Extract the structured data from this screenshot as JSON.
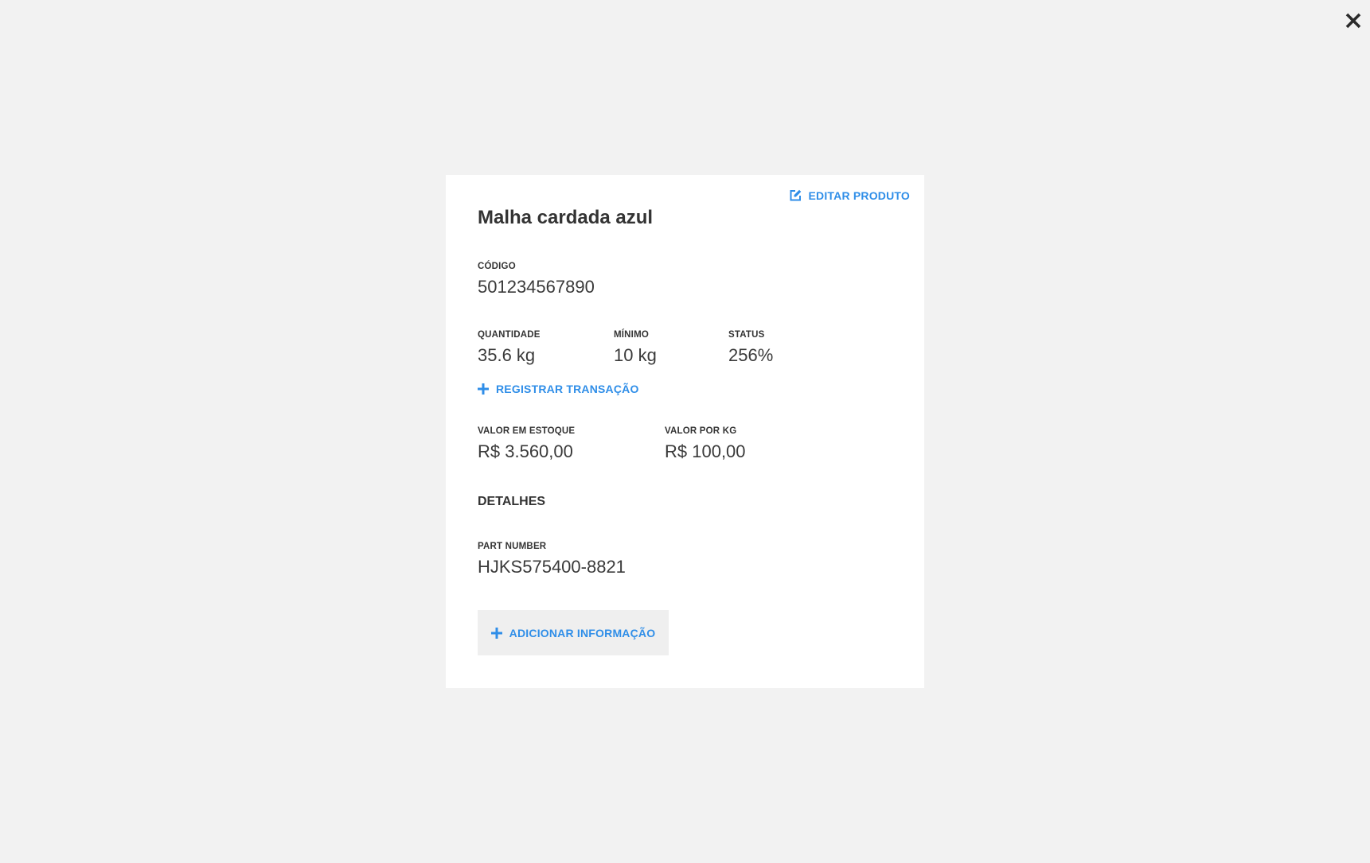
{
  "icons": {
    "close": "close-icon",
    "edit": "edit-icon",
    "plus": "plus-icon"
  },
  "colors": {
    "accent": "#2f8ee8",
    "background": "#f2f2f2",
    "card": "#ffffff",
    "button_bg": "#efefef",
    "text": "#333333"
  },
  "product": {
    "title": "Malha cardada azul",
    "edit_label": "EDITAR PRODUTO"
  },
  "fields": {
    "codigo": {
      "label": "CÓDIGO",
      "value": "501234567890"
    },
    "quantidade": {
      "label": "QUANTIDADE",
      "value": "35.6 kg"
    },
    "minimo": {
      "label": "MÍNIMO",
      "value": "10 kg"
    },
    "status": {
      "label": "STATUS",
      "value": "256%"
    },
    "valor_estoque": {
      "label": "VALOR EM ESTOQUE",
      "value": "R$ 3.560,00"
    },
    "valor_kg": {
      "label": "VALOR POR KG",
      "value": "R$ 100,00"
    }
  },
  "actions": {
    "register_transaction": "REGISTRAR TRANSAÇÃO",
    "add_info": "ADICIONAR INFORMAÇÃO"
  },
  "details": {
    "heading": "DETALHES",
    "items": [
      {
        "label": "PART NUMBER",
        "value": "HJKS575400-8821"
      }
    ]
  }
}
